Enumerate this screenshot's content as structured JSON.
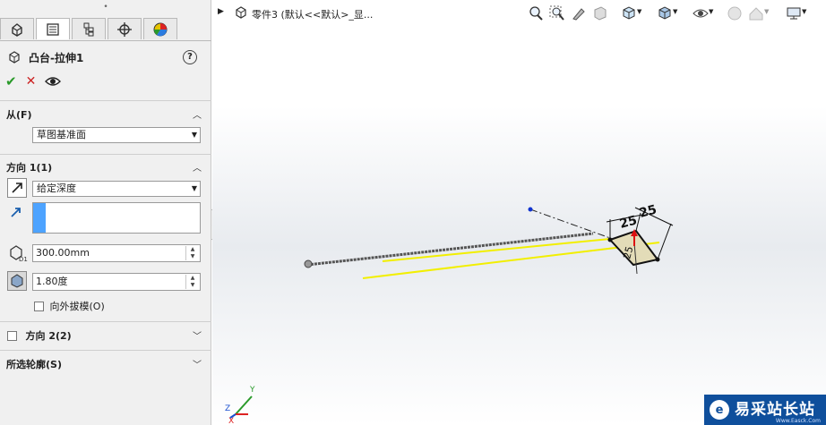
{
  "panel": {
    "grip": "•",
    "tabs": [
      "feature-manager-icon",
      "property-manager-icon",
      "configuration-manager-icon",
      "dim-xpert-icon",
      "display-manager-icon"
    ],
    "title": "凸台-拉伸1",
    "help": "?",
    "actions": {
      "ok": "✔",
      "cancel": "✕"
    },
    "from": {
      "header": "从(F)",
      "select": "草图基准面"
    },
    "direction1": {
      "header": "方向 1(1)",
      "end_condition": "给定深度",
      "depth": "300.00mm",
      "draft_angle": "1.80度",
      "draft_outward_label": "向外拔模(O)"
    },
    "direction2": {
      "header": "方向 2(2)"
    },
    "contours": {
      "header": "所选轮廓(S)"
    }
  },
  "viewport": {
    "breadcrumb": "零件3  (默认<<默认>_显...",
    "dimensions": [
      "25",
      "25"
    ],
    "triad": {
      "x": "X",
      "y": "Y",
      "z": "Z"
    }
  },
  "watermark": {
    "logo": "e",
    "text": "易采站长站",
    "sub": "Www.Easck.Com"
  },
  "colors": {
    "accent_blue": "#4da3ff",
    "ok_green": "#2a9a2a",
    "cancel_red": "#cc2222",
    "preview_yellow": "#f2ef00",
    "watermark_blue": "#0f4f9c"
  }
}
